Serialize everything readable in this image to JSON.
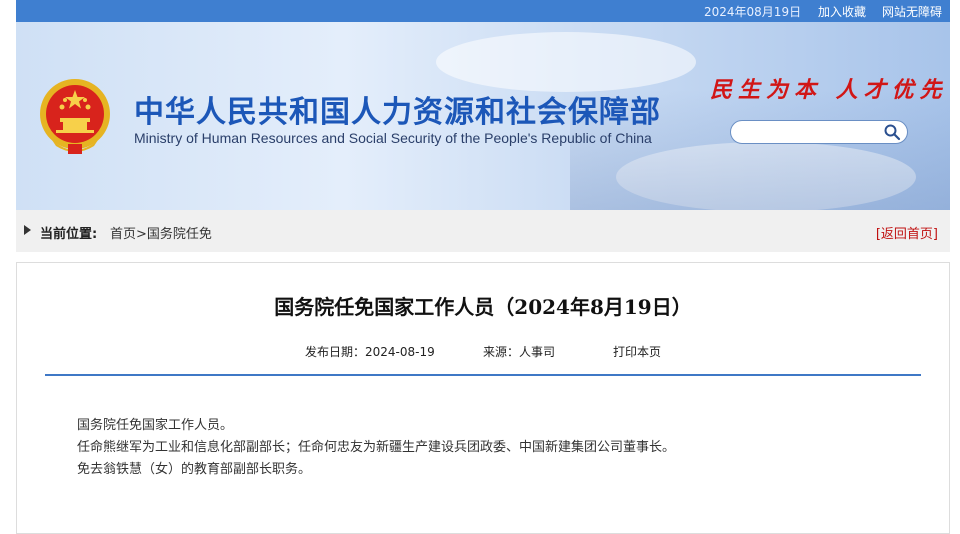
{
  "topbar": {
    "date": "2024年08月19日",
    "favorite_link": "加入收藏",
    "accessibility_link": "网站无障碍"
  },
  "header": {
    "title_cn": "中华人民共和国人力资源和社会保障部",
    "title_en": "Ministry of Human Resources and Social Security of the People's Republic of China",
    "slogan": "民生为本 人才优先",
    "search_placeholder": ""
  },
  "breadcrumb": {
    "label": "当前位置:",
    "path": "首页>国务院任免",
    "back_link": "[返回首页]"
  },
  "article": {
    "title": "国务院任免国家工作人员（2024年8月19日）",
    "publish_date": "发布日期：2024-08-19",
    "source": "来源：人事司",
    "print_link": "打印本页",
    "paragraphs": [
      "国务院任免国家工作人员。",
      "任命熊继军为工业和信息化部副部长；任命何忠友为新疆生产建设兵团政委、中国新建集团公司董事长。",
      "免去翁铁慧（女）的教育部副部长职务。"
    ]
  },
  "colors": {
    "header_blue": "#1c57b8",
    "slogan_red": "#d11616",
    "rule_blue": "#3f78c6",
    "back_red": "#c01010"
  }
}
